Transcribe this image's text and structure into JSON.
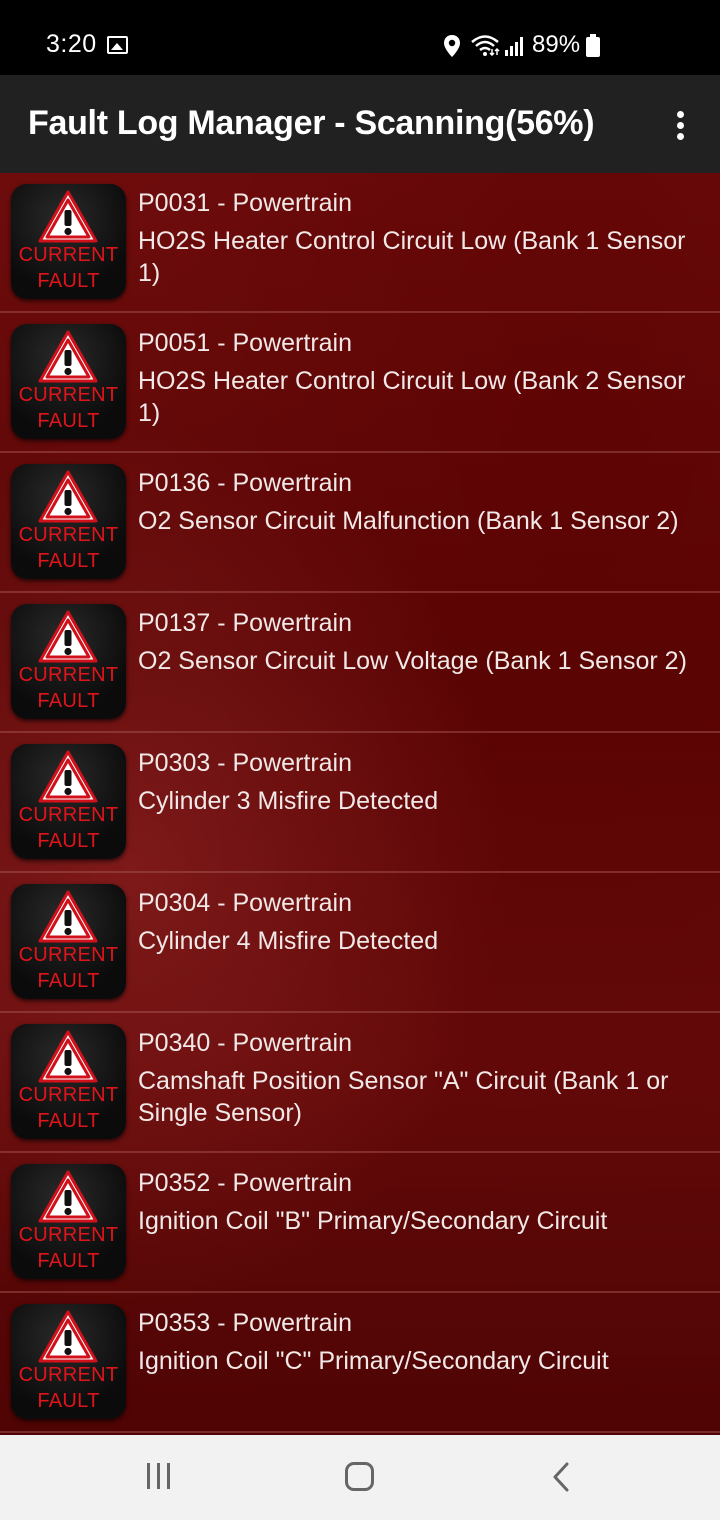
{
  "status_bar": {
    "time": "3:20",
    "battery": "89%",
    "icons": [
      "image-icon",
      "location-icon",
      "wifi-icon",
      "signal-icon",
      "battery-icon"
    ]
  },
  "app_bar": {
    "title": "Fault Log Manager - Scanning(56%)",
    "menu_icon": "more-vert-icon"
  },
  "badge": {
    "line1": "CURRENT",
    "line2": "FAULT",
    "icon": "warning-icon"
  },
  "faults": [
    {
      "code": "P0031 - Powertrain",
      "description": "HO2S Heater Control Circuit Low (Bank 1 Sensor 1)"
    },
    {
      "code": "P0051 - Powertrain",
      "description": "HO2S Heater Control Circuit Low (Bank 2 Sensor 1)"
    },
    {
      "code": "P0136 - Powertrain",
      "description": "O2 Sensor Circuit Malfunction (Bank 1 Sensor 2)"
    },
    {
      "code": "P0137 - Powertrain",
      "description": "O2 Sensor Circuit Low Voltage (Bank 1 Sensor 2)"
    },
    {
      "code": "P0303 - Powertrain",
      "description": "Cylinder 3 Misfire Detected"
    },
    {
      "code": "P0304 - Powertrain",
      "description": "Cylinder 4 Misfire Detected"
    },
    {
      "code": "P0340 - Powertrain",
      "description": "Camshaft Position Sensor \"A\" Circuit (Bank 1 or Single Sensor)"
    },
    {
      "code": "P0352 - Powertrain",
      "description": "Ignition Coil \"B\" Primary/Secondary Circuit"
    },
    {
      "code": "P0353 - Powertrain",
      "description": "Ignition Coil \"C\" Primary/Secondary Circuit"
    }
  ],
  "nav_bar": {
    "icons": [
      "recents-icon",
      "home-icon",
      "back-icon"
    ]
  },
  "colors": {
    "background_red": "#5b0606",
    "app_bar": "#212121",
    "badge_text": "#e0141a",
    "nav_bar": "#f2f2f2"
  }
}
